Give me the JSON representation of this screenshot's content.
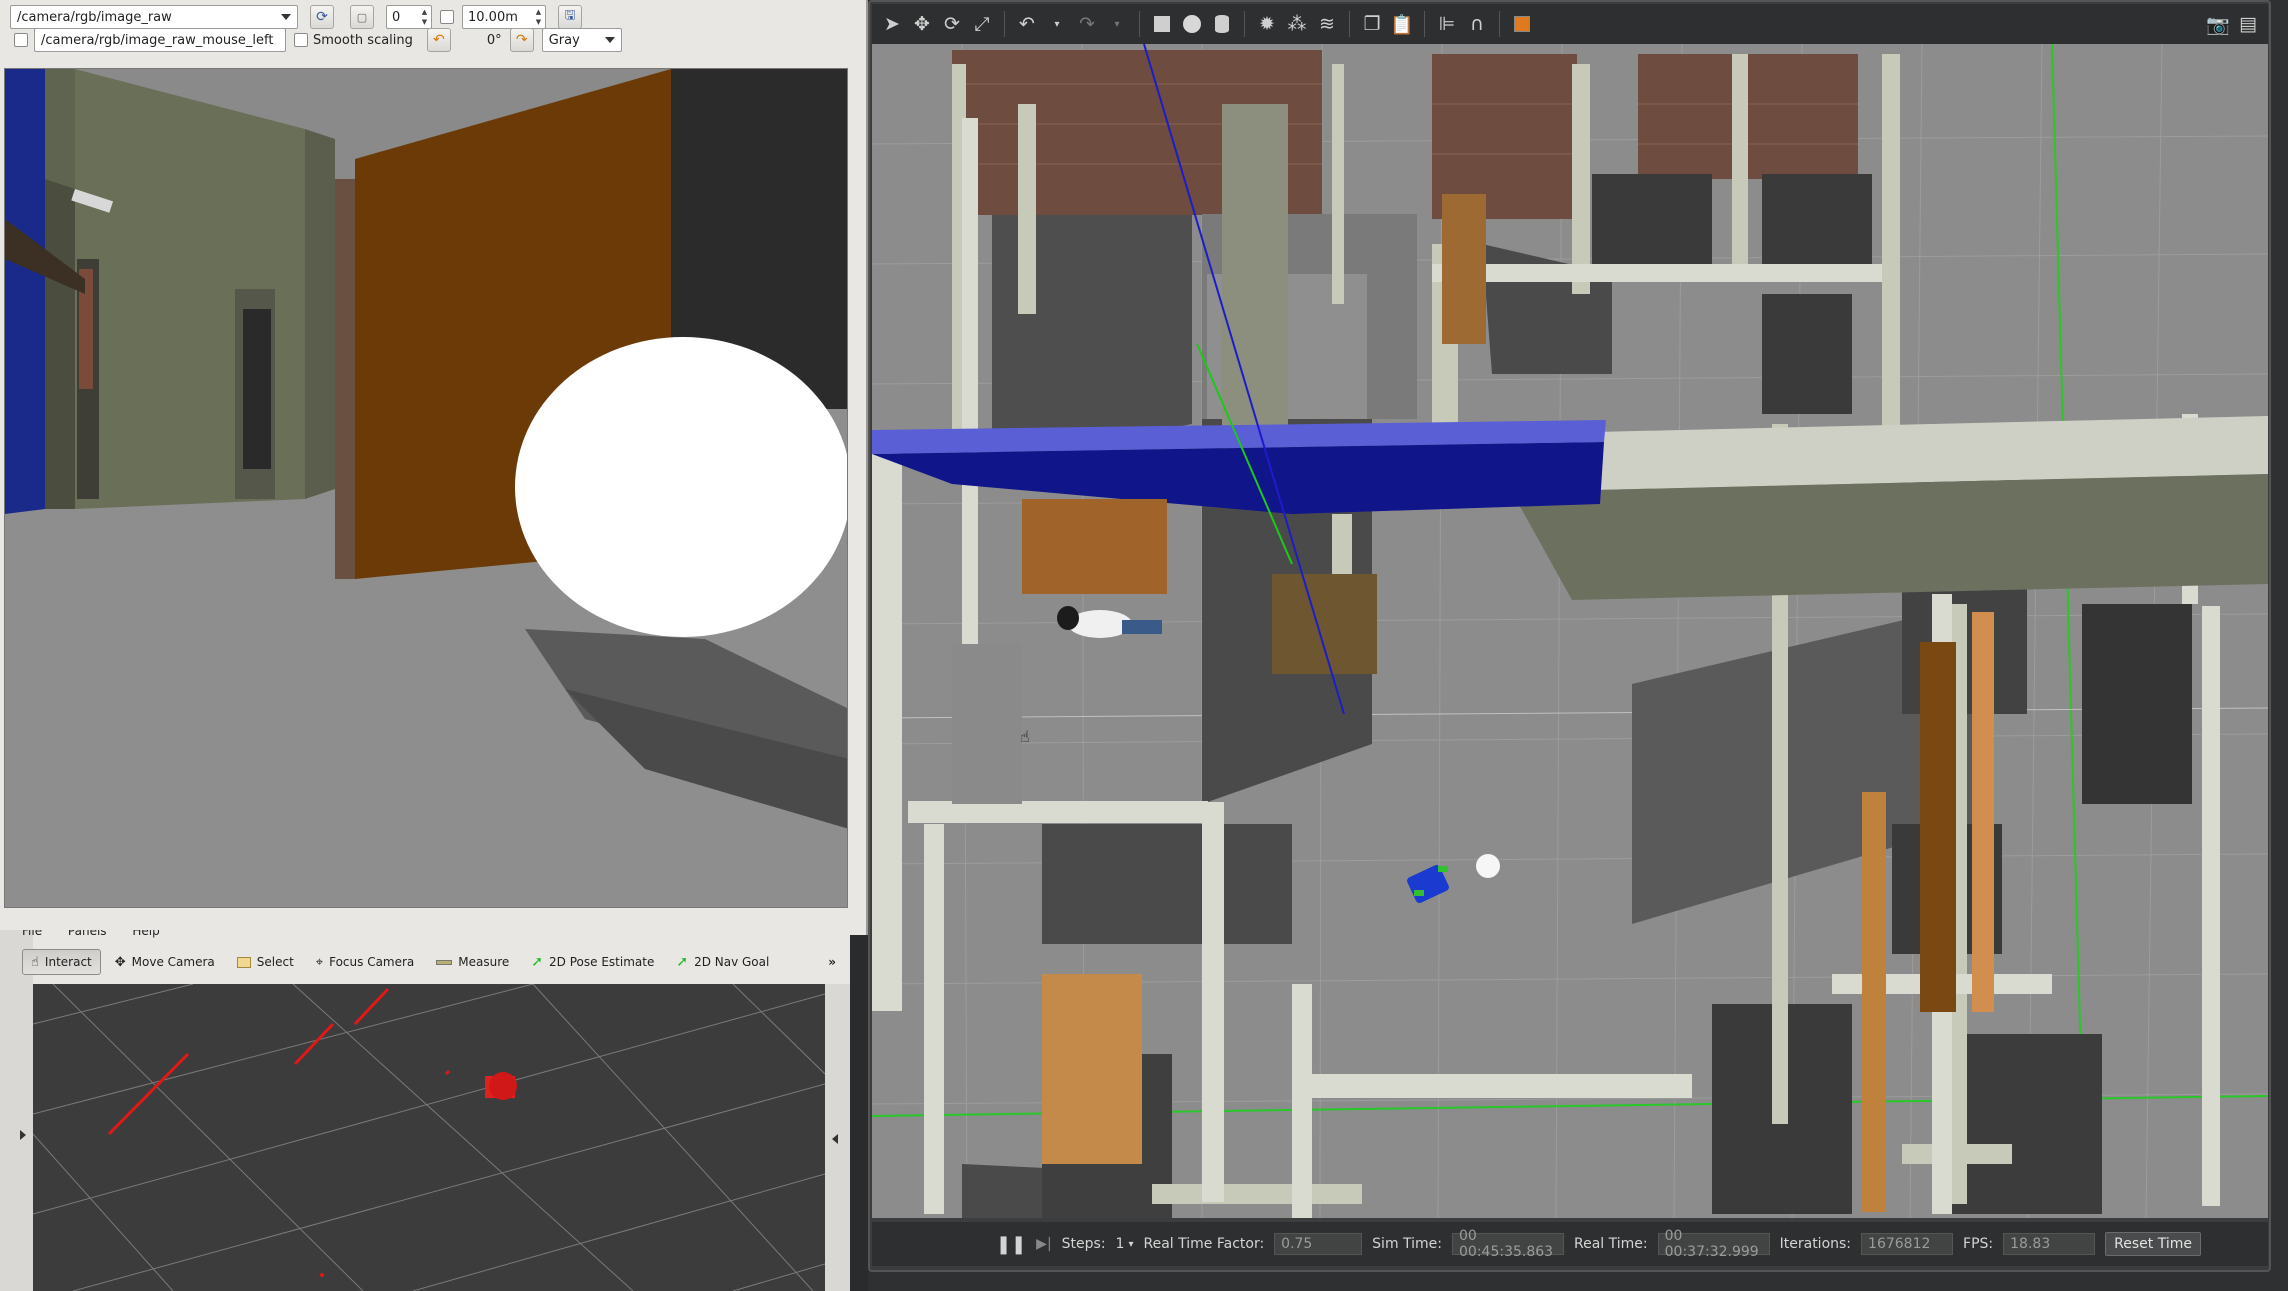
{
  "image_view": {
    "topic": "/camera/rgb/image_raw",
    "mouse_topic": "/camera/rgb/image_raw_mouse_left",
    "spin_value": "0",
    "max_range": "10.00m",
    "smooth_scaling_label": "Smooth scaling",
    "rotation": "0°",
    "colormap": "Gray"
  },
  "rviz": {
    "menu": [
      "File",
      "Panels",
      "Help"
    ],
    "tools": [
      {
        "label": "Interact",
        "icon": "hand-icon"
      },
      {
        "label": "Move Camera",
        "icon": "move-camera-icon"
      },
      {
        "label": "Select",
        "icon": "select-icon"
      },
      {
        "label": "Focus Camera",
        "icon": "focus-icon"
      },
      {
        "label": "Measure",
        "icon": "ruler-icon"
      },
      {
        "label": "2D Pose Estimate",
        "icon": "green-arrow-icon"
      },
      {
        "label": "2D Nav Goal",
        "icon": "green-arrow-icon"
      }
    ],
    "overflow": "»"
  },
  "gazebo": {
    "status": {
      "steps_label": "Steps:",
      "steps_value": "1",
      "rtf_label": "Real Time Factor:",
      "rtf_value": "0.75",
      "sim_time_label": "Sim Time:",
      "sim_time_value": "00 00:45:35.863",
      "real_time_label": "Real Time:",
      "real_time_value": "00 00:37:32.999",
      "iterations_label": "Iterations:",
      "iterations_value": "1676812",
      "fps_label": "FPS:",
      "fps_value": "18.83",
      "reset_label": "Reset Time"
    }
  },
  "colors": {
    "gazebo_bg": "#2e2f30",
    "wall": "#c8cabc",
    "floor": "#8d8d8d",
    "robot": "#1a3ad0",
    "rviz_scan": "#e01818"
  }
}
